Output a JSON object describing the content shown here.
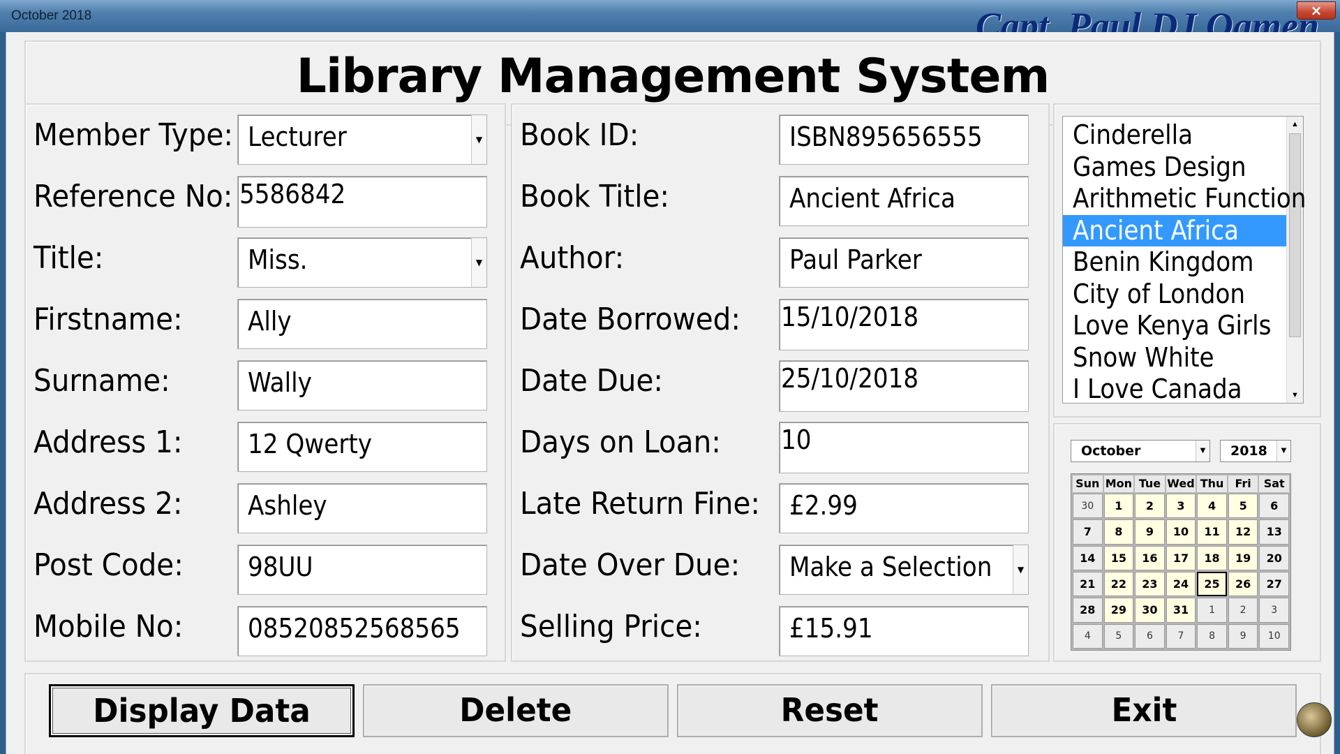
{
  "window": {
    "title": "October 2018",
    "watermark": "Capt. Paul DJ Oamen",
    "close_symbol": "×"
  },
  "header": {
    "title": "Library Management System"
  },
  "member": {
    "labels": {
      "member_type": "Member Type:",
      "reference_no": "Reference No:",
      "title": "Title:",
      "firstname": "Firstname:",
      "surname": "Surname:",
      "address1": "Address 1:",
      "address2": "Address 2:",
      "post_code": "Post Code:",
      "mobile_no": "Mobile No:"
    },
    "values": {
      "member_type": "Lecturer",
      "reference_no": "5586842",
      "title": "Miss.",
      "firstname": "Ally",
      "surname": "Wally",
      "address1": "12 Qwerty",
      "address2": "Ashley",
      "post_code": "98UU",
      "mobile_no": "08520852568565"
    }
  },
  "book": {
    "labels": {
      "book_id": "Book ID:",
      "book_title": "Book Title:",
      "author": "Author:",
      "date_borrowed": "Date Borrowed:",
      "date_due": "Date Due:",
      "days_on_loan": "Days on Loan:",
      "late_return_fine": "Late Return Fine:",
      "date_over_due": "Date Over Due:",
      "selling_price": "Selling Price:"
    },
    "values": {
      "book_id": "ISBN895656555",
      "book_title": "Ancient Africa",
      "author": "Paul Parker",
      "date_borrowed": "15/10/2018",
      "date_due": "25/10/2018",
      "days_on_loan": "10",
      "late_return_fine": "£2.99",
      "date_over_due": "Make a Selection",
      "selling_price": "£15.91"
    }
  },
  "book_list": {
    "items": [
      "Cinderella",
      "Games Design",
      "Arithmetic Function",
      "Ancient Africa",
      "Benin Kingdom",
      "City of London",
      "Love Kenya Girls",
      "Snow White",
      "I Love Canada"
    ],
    "selected": "Ancient Africa"
  },
  "calendar": {
    "month": "October",
    "year": "2018",
    "weekdays": [
      "Sun",
      "Mon",
      "Tue",
      "Wed",
      "Thu",
      "Fri",
      "Sat"
    ],
    "days": [
      "30",
      "1",
      "2",
      "3",
      "4",
      "5",
      "6",
      "7",
      "8",
      "9",
      "10",
      "11",
      "12",
      "13",
      "14",
      "15",
      "16",
      "17",
      "18",
      "19",
      "20",
      "21",
      "22",
      "23",
      "24",
      "25",
      "26",
      "27",
      "28",
      "29",
      "30",
      "31",
      "1",
      "2",
      "3",
      "4",
      "5",
      "6",
      "7",
      "8",
      "9",
      "10"
    ],
    "today": "25"
  },
  "buttons": {
    "display": "Display Data",
    "delete": "Delete",
    "reset": "Reset",
    "exit": "Exit"
  },
  "icons": {
    "dropdown": "chevron-down-icon",
    "scroll_up": "scroll-up-arrow-icon",
    "scroll_down": "scroll-down-arrow-icon",
    "corner_logo": "app-logo-icon"
  },
  "colors": {
    "selection": "#3399ff",
    "calendar_day_bg": "#ffffe1",
    "window_bg": "#f0f0f0"
  }
}
